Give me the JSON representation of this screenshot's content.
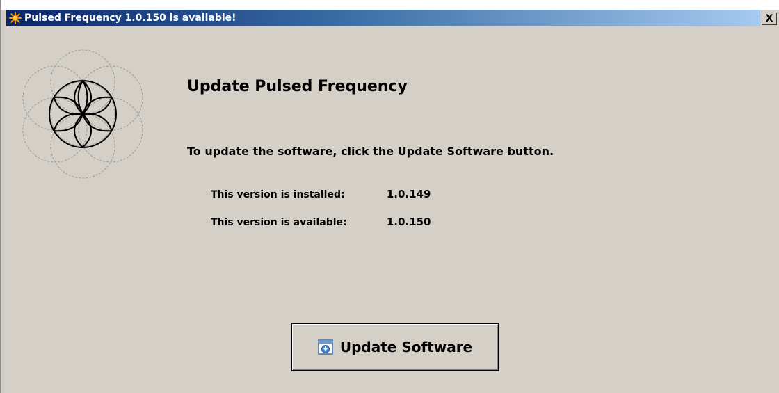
{
  "window": {
    "title": "Pulsed Frequency 1.0.150 is available!",
    "close_symbol": "X"
  },
  "icons": {
    "app": "starburst-icon",
    "close": "close-icon",
    "logo": "flower-of-life-logo",
    "update": "download-arrow-icon"
  },
  "main": {
    "heading": "Update Pulsed Frequency",
    "instruction": "To update the software, click the Update Software button.",
    "installed_label": "This version is installed:",
    "installed_value": "1.0.149",
    "available_label": "This version is available:",
    "available_value": "1.0.150"
  },
  "button": {
    "label": "Update Software"
  },
  "colors": {
    "window_bg": "#d4d0c8",
    "title_start": "#0a246a",
    "title_end": "#a6caf0",
    "app_icon": "#ff9900"
  }
}
